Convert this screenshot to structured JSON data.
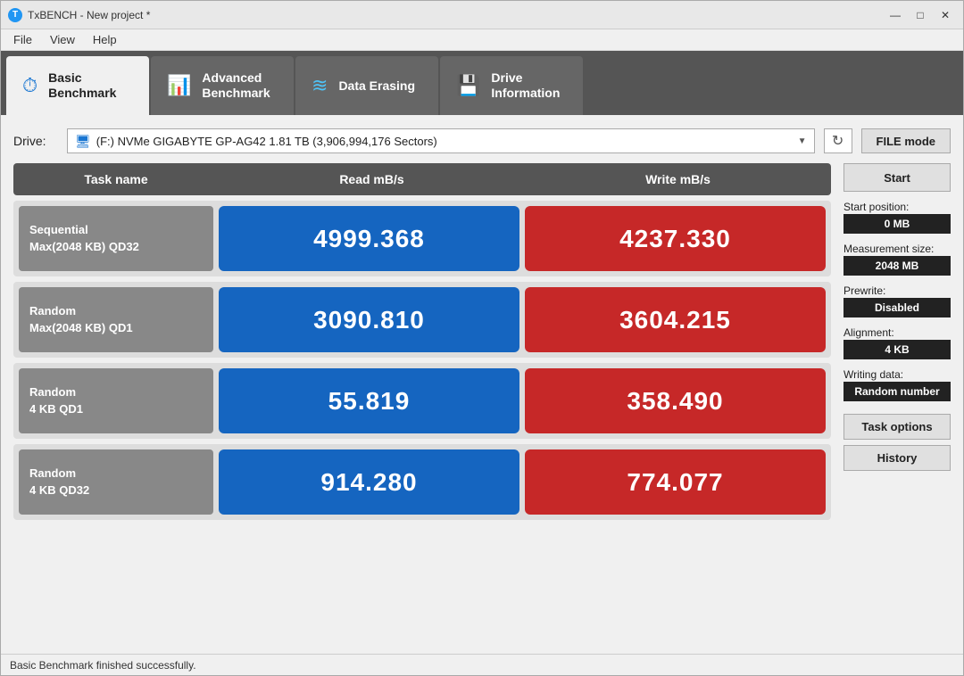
{
  "window": {
    "title": "TxBENCH - New project *",
    "icon": "T",
    "controls": {
      "minimize": "—",
      "maximize": "□",
      "close": "✕"
    }
  },
  "menu": {
    "items": [
      "File",
      "View",
      "Help"
    ]
  },
  "tabs": [
    {
      "id": "basic",
      "label_line1": "Basic",
      "label_line2": "Benchmark",
      "icon": "⏱",
      "active": true
    },
    {
      "id": "advanced",
      "label_line1": "Advanced",
      "label_line2": "Benchmark",
      "icon": "📊",
      "active": false
    },
    {
      "id": "erasing",
      "label_line1": "Data Erasing",
      "label_line2": "",
      "icon": "≋",
      "active": false
    },
    {
      "id": "drive",
      "label_line1": "Drive",
      "label_line2": "Information",
      "icon": "💾",
      "active": false
    }
  ],
  "drive": {
    "label": "Drive:",
    "value": "(F:) NVMe GIGABYTE GP-AG42  1.81 TB (3,906,994,176 Sectors)",
    "refresh_icon": "↻",
    "file_mode_label": "FILE mode"
  },
  "table": {
    "headers": {
      "task": "Task name",
      "read": "Read mB/s",
      "write": "Write mB/s"
    },
    "rows": [
      {
        "task": "Sequential\nMax(2048 KB) QD32",
        "read": "4999.368",
        "write": "4237.330"
      },
      {
        "task": "Random\nMax(2048 KB) QD1",
        "read": "3090.810",
        "write": "3604.215"
      },
      {
        "task": "Random\n4 KB QD1",
        "read": "55.819",
        "write": "358.490"
      },
      {
        "task": "Random\n4 KB QD32",
        "read": "914.280",
        "write": "774.077"
      }
    ]
  },
  "sidebar": {
    "start_label": "Start",
    "params": [
      {
        "label": "Start position:",
        "value": "0 MB"
      },
      {
        "label": "Measurement size:",
        "value": "2048 MB"
      },
      {
        "label": "Prewrite:",
        "value": "Disabled"
      },
      {
        "label": "Alignment:",
        "value": "4 KB"
      },
      {
        "label": "Writing data:",
        "value": "Random number"
      }
    ],
    "task_options_label": "Task options",
    "history_label": "History"
  },
  "status": {
    "text": "Basic Benchmark finished successfully."
  }
}
